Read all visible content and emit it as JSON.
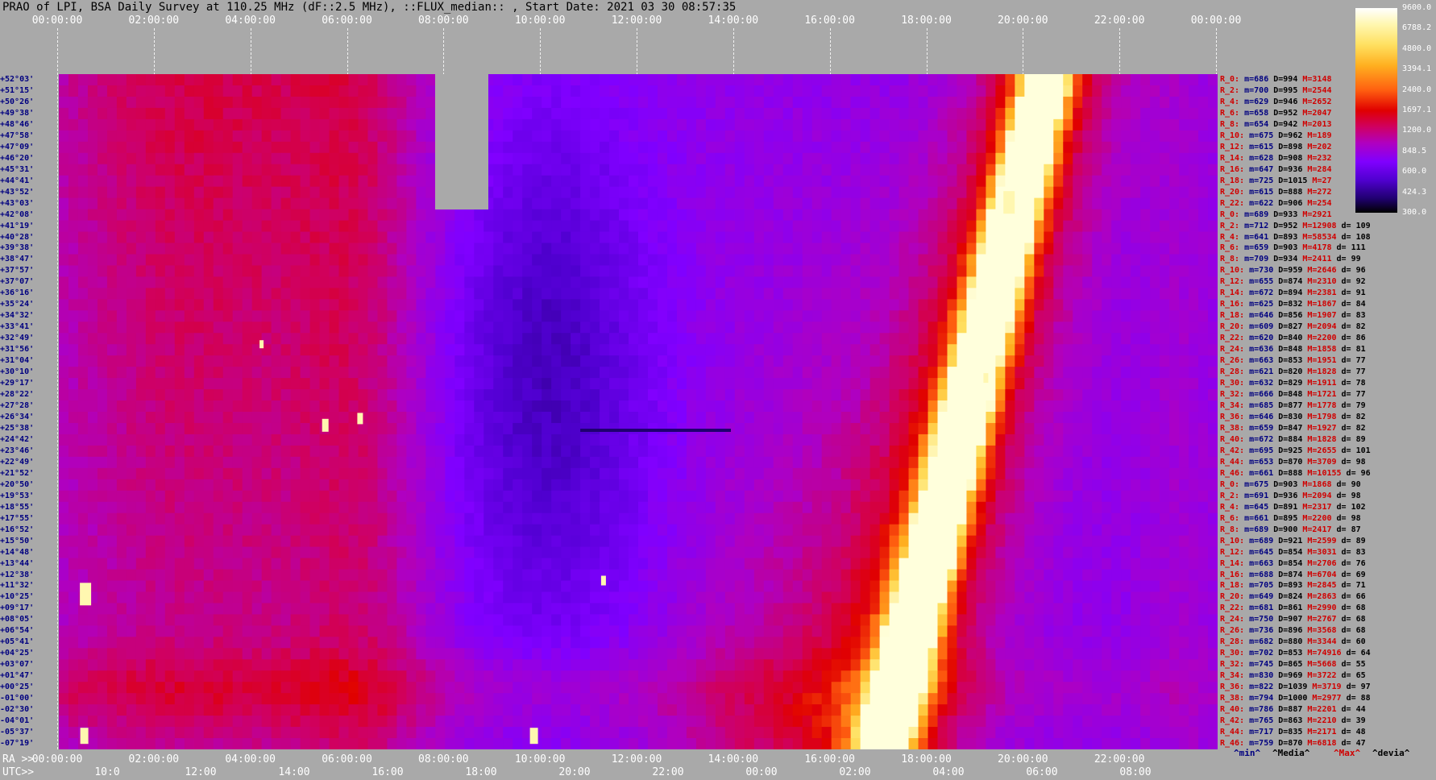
{
  "title": "PRAO of LPI, BSA Daily Survey at 110.25 MHz (dF::2.5 MHz), ::FLUX_median:: , Start Date: 2021 03 30 08:57:35",
  "top_axis": [
    "00:00:00",
    "02:00:00",
    "04:00:00",
    "06:00:00",
    "08:00:00",
    "10:00:00",
    "12:00:00",
    "14:00:00",
    "16:00:00",
    "18:00:00",
    "20:00:00",
    "22:00:00",
    "00:00:00"
  ],
  "bottom_ra": {
    "prefix": "RA >>",
    "ticks": [
      "00:00:00",
      "02:00:00",
      "04:00:00",
      "06:00:00",
      "08:00:00",
      "10:00:00",
      "12:00:00",
      "14:00:00",
      "16:00:00",
      "18:00:00",
      "20:00:00",
      "22:00:00"
    ]
  },
  "bottom_utc": {
    "prefix": "UTC>>",
    "ticks": [
      "10:0",
      "12:00",
      "14:00",
      "16:00",
      "18:00",
      "20:00",
      "22:00",
      "00:00",
      "02:00",
      "04:00",
      "06:00",
      "08:00"
    ]
  },
  "colorbar": {
    "ticks": [
      "9600.0",
      "6788.2",
      "4800.0",
      "3394.1",
      "2400.0",
      "1697.1",
      "1200.0",
      "848.5",
      "600.0",
      "424.3",
      "300.0"
    ]
  },
  "declinations": [
    "+52°03'",
    "+51°15'",
    "+50°26'",
    "+49°38'",
    "+48°46'",
    "+47°58'",
    "+47°09'",
    "+46°20'",
    "+45°31'",
    "+44°41'",
    "+43°52'",
    "+43°03'",
    "+42°08'",
    "+41°19'",
    "+40°28'",
    "+39°38'",
    "+38°47'",
    "+37°57'",
    "+37°07'",
    "+36°16'",
    "+35°24'",
    "+34°32'",
    "+33°41'",
    "+32°49'",
    "+31°56'",
    "+31°04'",
    "+30°10'",
    "+29°17'",
    "+28°22'",
    "+27°28'",
    "+26°34'",
    "+25°38'",
    "+24°42'",
    "+23°46'",
    "+22°49'",
    "+21°52'",
    "+20°50'",
    "+19°53'",
    "+18°55'",
    "+17°55'",
    "+16°52'",
    "+15°50'",
    "+14°48'",
    "+13°44'",
    "+12°38'",
    "+11°32'",
    "+10°25'",
    "+09°17'",
    "+08°05'",
    "+06°54'",
    "+05°41'",
    "+04°25'",
    "+03°07'",
    "+01°47'",
    "+00°25'",
    "-01°00'",
    "-02°30'",
    "-04°01'",
    "-05°37'",
    "-07°19'"
  ],
  "stats": [
    {
      "r": "R_0:",
      "m": "m=686",
      "d": "D=994",
      "M": "M=3148",
      "dv": ""
    },
    {
      "r": "R_2:",
      "m": "m=700",
      "d": "D=995",
      "M": "M=2544",
      "dv": ""
    },
    {
      "r": "R_4:",
      "m": "m=629",
      "d": "D=946",
      "M": "M=2652",
      "dv": ""
    },
    {
      "r": "R_6:",
      "m": "m=658",
      "d": "D=952",
      "M": "M=2047",
      "dv": ""
    },
    {
      "r": "R_8:",
      "m": "m=654",
      "d": "D=942",
      "M": "M=2013",
      "dv": ""
    },
    {
      "r": "R_10:",
      "m": "m=675",
      "d": "D=962",
      "M": "M=189",
      "dv": ""
    },
    {
      "r": "R_12:",
      "m": "m=615",
      "d": "D=898",
      "M": "M=202",
      "dv": ""
    },
    {
      "r": "R_14:",
      "m": "m=628",
      "d": "D=908",
      "M": "M=232",
      "dv": ""
    },
    {
      "r": "R_16:",
      "m": "m=647",
      "d": "D=936",
      "M": "M=284",
      "dv": ""
    },
    {
      "r": "R_18:",
      "m": "m=725",
      "d": "D=1015",
      "M": "M=27",
      "dv": ""
    },
    {
      "r": "R_20:",
      "m": "m=615",
      "d": "D=888",
      "M": "M=272",
      "dv": ""
    },
    {
      "r": "R_22:",
      "m": "m=622",
      "d": "D=906",
      "M": "M=254",
      "dv": ""
    },
    {
      "r": "R_0:",
      "m": "m=689",
      "d": "D=933",
      "M": "M=2921",
      "dv": ""
    },
    {
      "r": "R_2:",
      "m": "m=712",
      "d": "D=952",
      "M": "M=12908",
      "dv": "d= 109"
    },
    {
      "r": "R_4:",
      "m": "m=641",
      "d": "D=893",
      "M": "M=58534",
      "dv": "d= 108"
    },
    {
      "r": "R_6:",
      "m": "m=659",
      "d": "D=903",
      "M": "M=4178",
      "dv": "d= 111"
    },
    {
      "r": "R_8:",
      "m": "m=709",
      "d": "D=934",
      "M": "M=2411",
      "dv": "d= 99"
    },
    {
      "r": "R_10:",
      "m": "m=730",
      "d": "D=959",
      "M": "M=2646",
      "dv": "d= 96"
    },
    {
      "r": "R_12:",
      "m": "m=655",
      "d": "D=874",
      "M": "M=2310",
      "dv": "d= 92"
    },
    {
      "r": "R_14:",
      "m": "m=672",
      "d": "D=894",
      "M": "M=2381",
      "dv": "d= 91"
    },
    {
      "r": "R_16:",
      "m": "m=625",
      "d": "D=832",
      "M": "M=1867",
      "dv": "d= 84"
    },
    {
      "r": "R_18:",
      "m": "m=646",
      "d": "D=856",
      "M": "M=1907",
      "dv": "d= 83"
    },
    {
      "r": "R_20:",
      "m": "m=609",
      "d": "D=827",
      "M": "M=2094",
      "dv": "d= 82"
    },
    {
      "r": "R_22:",
      "m": "m=620",
      "d": "D=840",
      "M": "M=2200",
      "dv": "d= 86"
    },
    {
      "r": "R_24:",
      "m": "m=636",
      "d": "D=848",
      "M": "M=1858",
      "dv": "d= 81"
    },
    {
      "r": "R_26:",
      "m": "m=663",
      "d": "D=853",
      "M": "M=1951",
      "dv": "d= 77"
    },
    {
      "r": "R_28:",
      "m": "m=621",
      "d": "D=820",
      "M": "M=1828",
      "dv": "d= 77"
    },
    {
      "r": "R_30:",
      "m": "m=632",
      "d": "D=829",
      "M": "M=1911",
      "dv": "d= 78"
    },
    {
      "r": "R_32:",
      "m": "m=666",
      "d": "D=848",
      "M": "M=1721",
      "dv": "d= 77"
    },
    {
      "r": "R_34:",
      "m": "m=685",
      "d": "D=877",
      "M": "M=1778",
      "dv": "d= 79"
    },
    {
      "r": "R_36:",
      "m": "m=646",
      "d": "D=830",
      "M": "M=1798",
      "dv": "d= 82"
    },
    {
      "r": "R_38:",
      "m": "m=659",
      "d": "D=847",
      "M": "M=1927",
      "dv": "d= 82"
    },
    {
      "r": "R_40:",
      "m": "m=672",
      "d": "D=884",
      "M": "M=1828",
      "dv": "d= 89"
    },
    {
      "r": "R_42:",
      "m": "m=695",
      "d": "D=925",
      "M": "M=2655",
      "dv": "d= 101"
    },
    {
      "r": "R_44:",
      "m": "m=653",
      "d": "D=870",
      "M": "M=3709",
      "dv": "d= 98"
    },
    {
      "r": "R_46:",
      "m": "m=661",
      "d": "D=888",
      "M": "M=10155",
      "dv": "d= 96"
    },
    {
      "r": "R_0:",
      "m": "m=675",
      "d": "D=903",
      "M": "M=1868",
      "dv": "d= 90"
    },
    {
      "r": "R_2:",
      "m": "m=691",
      "d": "D=936",
      "M": "M=2094",
      "dv": "d= 98"
    },
    {
      "r": "R_4:",
      "m": "m=645",
      "d": "D=891",
      "M": "M=2317",
      "dv": "d= 102"
    },
    {
      "r": "R_6:",
      "m": "m=661",
      "d": "D=895",
      "M": "M=2200",
      "dv": "d= 98"
    },
    {
      "r": "R_8:",
      "m": "m=689",
      "d": "D=900",
      "M": "M=2417",
      "dv": "d= 87"
    },
    {
      "r": "R_10:",
      "m": "m=689",
      "d": "D=921",
      "M": "M=2599",
      "dv": "d= 89"
    },
    {
      "r": "R_12:",
      "m": "m=645",
      "d": "D=854",
      "M": "M=3031",
      "dv": "d= 83"
    },
    {
      "r": "R_14:",
      "m": "m=663",
      "d": "D=854",
      "M": "M=2706",
      "dv": "d= 76"
    },
    {
      "r": "R_16:",
      "m": "m=688",
      "d": "D=874",
      "M": "M=6704",
      "dv": "d= 69"
    },
    {
      "r": "R_18:",
      "m": "m=705",
      "d": "D=893",
      "M": "M=2845",
      "dv": "d= 71"
    },
    {
      "r": "R_20:",
      "m": "m=649",
      "d": "D=824",
      "M": "M=2863",
      "dv": "d= 66"
    },
    {
      "r": "R_22:",
      "m": "m=681",
      "d": "D=861",
      "M": "M=2990",
      "dv": "d= 68"
    },
    {
      "r": "R_24:",
      "m": "m=750",
      "d": "D=907",
      "M": "M=2767",
      "dv": "d= 68"
    },
    {
      "r": "R_26:",
      "m": "m=736",
      "d": "D=896",
      "M": "M=3568",
      "dv": "d= 68"
    },
    {
      "r": "R_28:",
      "m": "m=682",
      "d": "D=880",
      "M": "M=3344",
      "dv": "d= 60"
    },
    {
      "r": "R_30:",
      "m": "m=702",
      "d": "D=853",
      "M": "M=74916",
      "dv": "d= 64"
    },
    {
      "r": "R_32:",
      "m": "m=745",
      "d": "D=865",
      "M": "M=5668",
      "dv": "d= 55"
    },
    {
      "r": "R_34:",
      "m": "m=830",
      "d": "D=969",
      "M": "M=3722",
      "dv": "d= 65"
    },
    {
      "r": "R_36:",
      "m": "m=822",
      "d": "D=1039",
      "M": "M=3719",
      "dv": "d= 97"
    },
    {
      "r": "R_38:",
      "m": "m=794",
      "d": "D=1000",
      "M": "M=2977",
      "dv": "d= 88"
    },
    {
      "r": "R_40:",
      "m": "m=786",
      "d": "D=887",
      "M": "M=2201",
      "dv": "d= 44"
    },
    {
      "r": "R_42:",
      "m": "m=765",
      "d": "D=863",
      "M": "M=2210",
      "dv": "d= 39"
    },
    {
      "r": "R_44:",
      "m": "m=717",
      "d": "D=835",
      "M": "M=2171",
      "dv": "d= 48"
    },
    {
      "r": "R_46:",
      "m": "m=759",
      "d": "D=870",
      "M": "M=6818",
      "dv": "d= 47"
    }
  ],
  "legend": [
    "^min^",
    "^Media^",
    "^Max^",
    "^devia^"
  ],
  "colors": {
    "background": "#a9a9a9",
    "blank_block": "#a9a9a9",
    "legend_min": "#000080",
    "legend_media": "#000000",
    "legend_max": "#d00000",
    "legend_devia": "#000000"
  },
  "chart_data": {
    "type": "heatmap",
    "x_axis_top": "RA 00:00:00 to 00:00:00",
    "x_axis_bottom_utc": "10:00 to 08:00",
    "y_axis": "declination +52°03' to -07°19'",
    "colorbar_range": [
      300.0,
      9600.0
    ],
    "colorbar_scale": "log",
    "grid": true
  }
}
